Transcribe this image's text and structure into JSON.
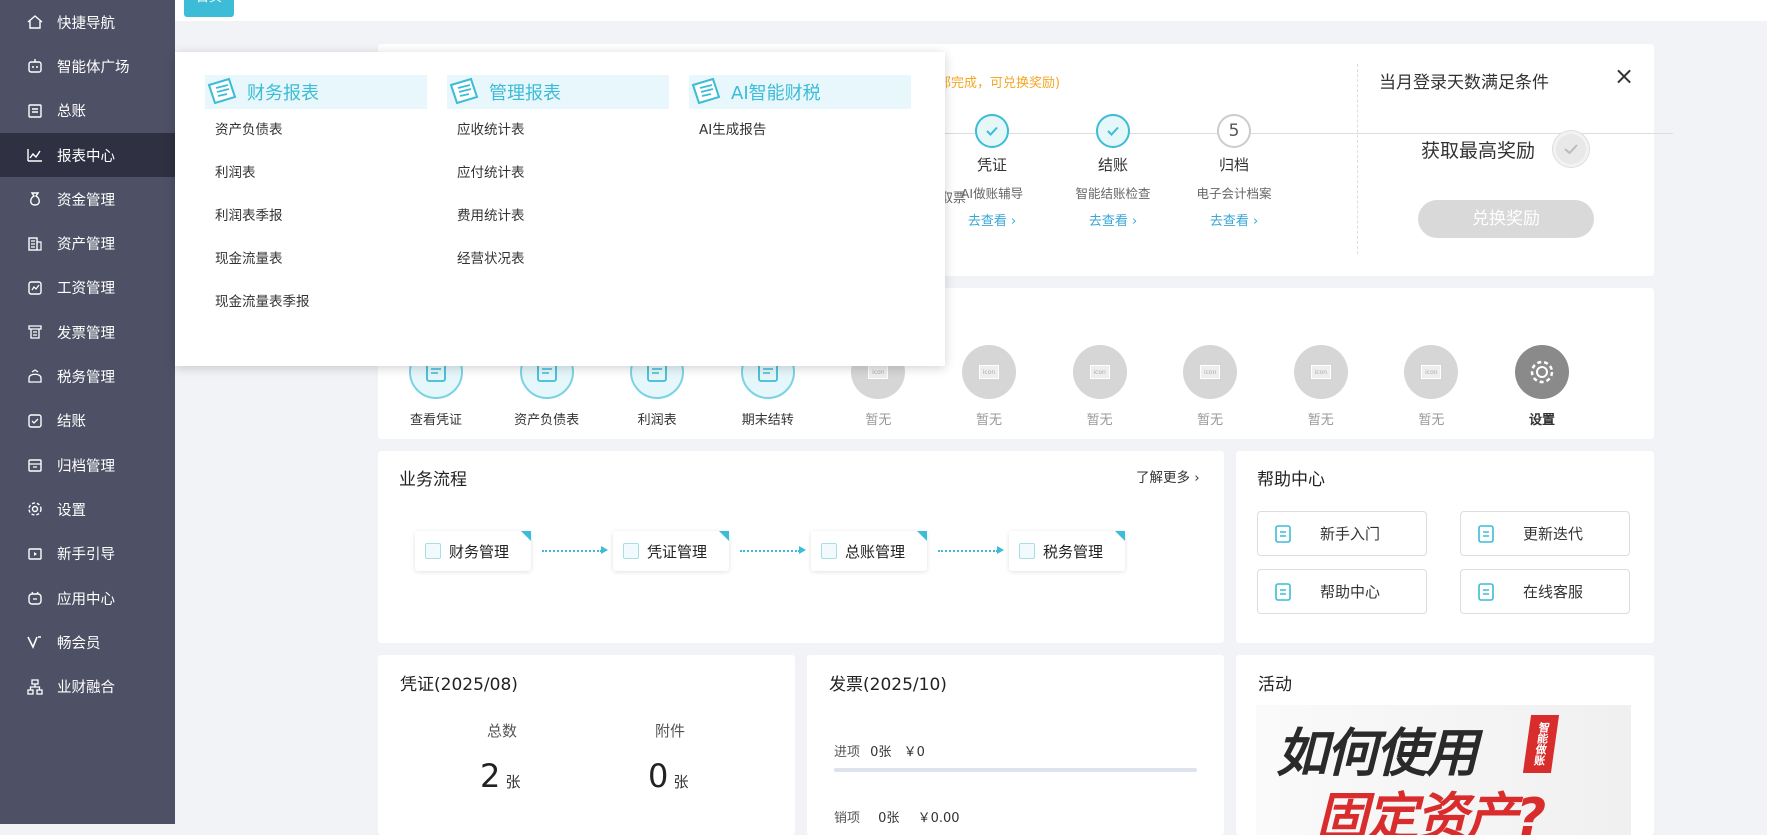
{
  "sidebar": {
    "items": [
      {
        "label": "快捷导航",
        "icon": "home-icon"
      },
      {
        "label": "智能体广场",
        "icon": "robot-icon"
      },
      {
        "label": "总账",
        "icon": "ledger-icon"
      },
      {
        "label": "报表中心",
        "icon": "chart-icon",
        "active": true
      },
      {
        "label": "资金管理",
        "icon": "money-bag-icon"
      },
      {
        "label": "资产管理",
        "icon": "building-icon"
      },
      {
        "label": "工资管理",
        "icon": "salary-icon"
      },
      {
        "label": "发票管理",
        "icon": "invoice-icon"
      },
      {
        "label": "税务管理",
        "icon": "tax-icon"
      },
      {
        "label": "结账",
        "icon": "checkout-icon"
      },
      {
        "label": "归档管理",
        "icon": "archive-icon"
      },
      {
        "label": "设置",
        "icon": "gear-icon"
      },
      {
        "label": "新手引导",
        "icon": "guide-icon"
      },
      {
        "label": "应用中心",
        "icon": "app-icon"
      },
      {
        "label": "畅会员",
        "icon": "vip-icon"
      },
      {
        "label": "业财融合",
        "icon": "org-icon"
      }
    ]
  },
  "header": {
    "home_tab": "首页"
  },
  "dropdown": {
    "columns": [
      {
        "title": "财务报表",
        "icon": "finance-report-icon",
        "items": [
          "资产负债表",
          "利润表",
          "利润表季报",
          "现金流量表",
          "现金流量表季报"
        ]
      },
      {
        "title": "管理报表",
        "icon": "management-report-icon",
        "items": [
          "应收统计表",
          "应付统计表",
          "费用统计表",
          "经营状况表"
        ]
      },
      {
        "title": "AI智能财税",
        "icon": "ai-tax-icon",
        "items": [
          "AI生成报告"
        ]
      }
    ]
  },
  "steps_card": {
    "hint": "部完成，可兑换奖励)",
    "partial_step_text": "取票",
    "steps": [
      {
        "name": "凭证",
        "desc": "AI做账辅导",
        "link": "去查看",
        "status": "done"
      },
      {
        "name": "结账",
        "desc": "智能结账检查",
        "link": "去查看",
        "status": "done"
      },
      {
        "name": "归档",
        "desc": "电子会计档案",
        "link": "去查看",
        "status": "pending",
        "number": "5"
      }
    ],
    "reward": {
      "title": "当月登录天数满足条件",
      "subtitle": "获取最高奖励",
      "button": "兑换奖励",
      "close": "×"
    }
  },
  "quick_actions": [
    {
      "label": "查看凭证",
      "icon": "voucher-search-icon",
      "state": "active"
    },
    {
      "label": "资产负债表",
      "icon": "balance-sheet-icon",
      "state": "active"
    },
    {
      "label": "利润表",
      "icon": "profit-chart-icon",
      "state": "active"
    },
    {
      "label": "期末结转",
      "icon": "period-end-icon",
      "state": "active"
    },
    {
      "label": "暂无",
      "icon": "placeholder-icon",
      "state": "empty"
    },
    {
      "label": "暂无",
      "icon": "placeholder-icon",
      "state": "empty"
    },
    {
      "label": "暂无",
      "icon": "placeholder-icon",
      "state": "empty"
    },
    {
      "label": "暂无",
      "icon": "placeholder-icon",
      "state": "empty"
    },
    {
      "label": "暂无",
      "icon": "placeholder-icon",
      "state": "empty"
    },
    {
      "label": "暂无",
      "icon": "placeholder-icon",
      "state": "empty"
    },
    {
      "label": "设置",
      "icon": "gear-icon",
      "state": "settings"
    }
  ],
  "placeholder_icon_text": "icon",
  "business_flow": {
    "title": "业务流程",
    "more": "了解更多",
    "nodes": [
      "财务管理",
      "凭证管理",
      "总账管理",
      "税务管理"
    ]
  },
  "help_center": {
    "title": "帮助中心",
    "buttons": [
      "新手入门",
      "更新迭代",
      "帮助中心",
      "在线客服"
    ]
  },
  "voucher": {
    "title": "凭证(2025/08)",
    "total_label": "总数",
    "total_value": "2",
    "total_unit": "张",
    "attach_label": "附件",
    "attach_value": "0",
    "attach_unit": "张"
  },
  "invoice": {
    "title": "发票(2025/10)",
    "in_label": "进项",
    "in_count": "0张",
    "in_amount": "￥0",
    "out_label": "销项",
    "out_count": "0张",
    "out_amount": "￥0.00"
  },
  "activity": {
    "title": "活动",
    "banner_line1": "如何使用",
    "banner_line2": "固定资产?",
    "banner_badge": "智能做账"
  },
  "colors": {
    "accent": "#3cbcd6",
    "sidebar": "#4e5166",
    "sidebar_active": "#2f3142",
    "hint": "#f5a623"
  }
}
